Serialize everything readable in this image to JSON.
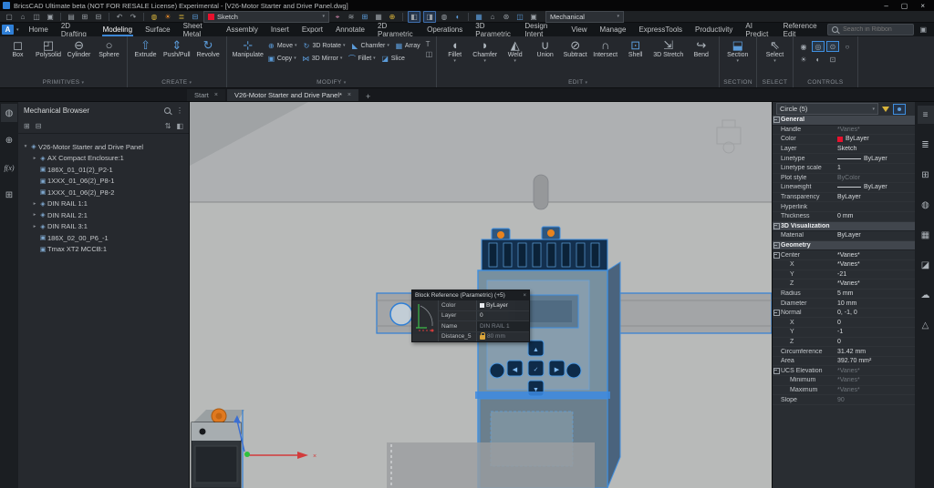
{
  "colors": {
    "accent": "#3c87d6",
    "selection_blue": "#2f7fd6",
    "layer_swatch_red": "#e8112d",
    "knob_orange": "#e0791f"
  },
  "window": {
    "title": "BricsCAD Ultimate beta (NOT FOR RESALE License) Experimental - [V26-Motor Starter and Drive Panel.dwg]",
    "controls": [
      {
        "name": "minimize",
        "g": "–"
      },
      {
        "name": "maximize",
        "g": "▢"
      },
      {
        "name": "close",
        "g": "×"
      }
    ]
  },
  "qat": {
    "left_icons": [
      {
        "n": "new-file-icon",
        "g": "▢"
      },
      {
        "n": "open-file-icon",
        "g": "⌂"
      },
      {
        "n": "save-icon",
        "g": "◫"
      },
      {
        "n": "save-all-icon",
        "g": "▣"
      },
      {
        "div": true
      },
      {
        "n": "new-sheet-icon",
        "g": "▤"
      },
      {
        "n": "plot-icon",
        "g": "⊞"
      },
      {
        "n": "publish-icon",
        "g": "⊟"
      },
      {
        "div": true
      },
      {
        "n": "undo-icon",
        "g": "↶"
      },
      {
        "n": "redo-icon",
        "g": "↷"
      },
      {
        "div": true
      },
      {
        "n": "lamp-icon",
        "g": "◍",
        "c": "y"
      },
      {
        "n": "sun-icon",
        "g": "☀",
        "c": "o"
      },
      {
        "n": "layers-icon",
        "g": "≣",
        "c": "y"
      },
      {
        "n": "print-icon",
        "g": "⊟",
        "c": "b"
      }
    ],
    "layer": {
      "name": "Sketch"
    },
    "mid_icons": [
      {
        "n": "annotation-monitor-icon",
        "g": "⌖",
        "c": "p"
      },
      {
        "n": "workspace-sync-icon",
        "g": "≋"
      },
      {
        "n": "snap-toggle-icon",
        "g": "⊞",
        "c": "b"
      },
      {
        "n": "grid-toggle-icon",
        "g": "▦"
      },
      {
        "n": "osnap-toggle-icon",
        "g": "⊕",
        "c": "y"
      },
      {
        "div": true
      },
      {
        "n": "quad-toggle-icon",
        "g": "◧",
        "f": true
      },
      {
        "n": "rollover-tips-icon",
        "g": "◨",
        "f": true
      },
      {
        "n": "world-ucs-icon",
        "g": "◍"
      },
      {
        "n": "shading-toggle-icon",
        "g": "◐",
        "c": "b"
      },
      {
        "div": true
      },
      {
        "n": "sheet-set-icon",
        "g": "▦",
        "c": "b"
      },
      {
        "n": "home-view-icon",
        "g": "⌂"
      },
      {
        "n": "settings-gear-icon",
        "g": "⊛"
      },
      {
        "n": "highlight-box-icon",
        "g": "◫",
        "c": "b"
      },
      {
        "n": "window-layout-icon",
        "g": "▣"
      }
    ],
    "workspace": "Mechanical"
  },
  "ribbon": {
    "search_placeholder": "Search in Ribbon",
    "tabs": [
      {
        "label": "Home"
      },
      {
        "label": "2D Drafting"
      },
      {
        "label": "Modeling",
        "active": true
      },
      {
        "label": "Surface"
      },
      {
        "label": "Sheet Metal"
      },
      {
        "label": "Assembly"
      },
      {
        "label": "Insert"
      },
      {
        "label": "Export"
      },
      {
        "label": "Annotate"
      },
      {
        "label": "2D Parametric"
      },
      {
        "label": "Operations"
      },
      {
        "label": "3D Parametric"
      },
      {
        "label": "Design Intent"
      },
      {
        "label": "View"
      },
      {
        "label": "Manage"
      },
      {
        "label": "ExpressTools"
      },
      {
        "label": "Productivity"
      },
      {
        "label": "AI Predict"
      },
      {
        "label": "Reference Edit"
      }
    ],
    "panels": [
      {
        "label": "PRIMITIVES",
        "caret": true,
        "kind": "big",
        "items": [
          {
            "label": "Box",
            "icon": "box-icon",
            "g": "◻"
          },
          {
            "label": "Polysolid",
            "icon": "polysolid-icon",
            "g": "◰"
          },
          {
            "label": "Cylinder",
            "icon": "cylinder-icon",
            "g": "⊖"
          },
          {
            "label": "Sphere",
            "icon": "sphere-icon",
            "g": "○"
          }
        ]
      },
      {
        "label": "CREATE",
        "caret": true,
        "kind": "big",
        "items": [
          {
            "label": "Extrude",
            "icon": "extrude-icon",
            "g": "⇧",
            "blue": true
          },
          {
            "label": "Push/Pull",
            "icon": "push-pull-icon",
            "g": "⇕",
            "blue": true
          },
          {
            "label": "Revolve",
            "icon": "revolve-icon",
            "g": "↻",
            "blue": true
          }
        ]
      },
      {
        "label": "MODIFY",
        "caret": true,
        "kind": "mixed",
        "big": [
          {
            "label": "Manipulate",
            "icon": "manipulate-icon",
            "g": "⊹",
            "blue": true
          }
        ],
        "rows": [
          [
            {
              "label": "Move",
              "icon": "move-icon",
              "g": "⊕",
              "caret": true
            },
            {
              "label": "3D Rotate",
              "icon": "rotate-3d-icon",
              "g": "↻",
              "caret": true
            },
            {
              "label": "Chamfer",
              "icon": "chamfer-icon",
              "g": "◣",
              "caret": true
            },
            {
              "label": "Array",
              "icon": "array-icon",
              "g": "▦"
            }
          ],
          [
            {
              "label": "Copy",
              "icon": "copy-icon",
              "g": "▣",
              "caret": true
            },
            {
              "label": "3D Mirror",
              "icon": "mirror-3d-icon",
              "g": "⋈",
              "caret": true
            },
            {
              "label": "Fillet",
              "icon": "fillet-icon",
              "g": "⌒",
              "caret": true
            },
            {
              "label": "Slice",
              "icon": "slice-icon",
              "g": "◪"
            }
          ]
        ],
        "tail": [
          {
            "icon": "text-style-icon",
            "g": "T"
          },
          {
            "icon": "convert-icon",
            "g": "◫"
          }
        ]
      },
      {
        "label": "EDIT",
        "caret": true,
        "kind": "big",
        "items": [
          {
            "label": "Fillet",
            "icon": "edit-fillet-icon",
            "g": "◖",
            "caret": true
          },
          {
            "label": "Chamfer",
            "icon": "edit-chamfer-icon",
            "g": "◗",
            "caret": true
          },
          {
            "label": "Weld",
            "icon": "weld-icon",
            "g": "◭",
            "caret": true
          },
          {
            "label": "Union",
            "icon": "union-icon",
            "g": "∪"
          },
          {
            "label": "Subtract",
            "icon": "subtract-icon",
            "g": "⊘"
          },
          {
            "label": "Intersect",
            "icon": "intersect-icon",
            "g": "∩"
          },
          {
            "label": "Shell",
            "icon": "shell-icon",
            "g": "⊡",
            "blue": true
          },
          {
            "label": "3D Stretch",
            "icon": "stretch-3d-icon",
            "g": "⇲"
          },
          {
            "label": "Bend",
            "icon": "bend-icon",
            "g": "↪"
          }
        ]
      },
      {
        "label": "SECTION",
        "kind": "big",
        "items": [
          {
            "label": "Section",
            "icon": "section-icon",
            "g": "⬓",
            "caret": true,
            "blue": true
          }
        ]
      },
      {
        "label": "SELECT",
        "kind": "big",
        "items": [
          {
            "label": "Select",
            "icon": "select-icon",
            "g": "⇖",
            "caret": true
          }
        ]
      },
      {
        "label": "CONTROLS",
        "kind": "grid",
        "rows": [
          [
            {
              "icon": "camera-swivel-icon",
              "g": "◉"
            },
            {
              "icon": "look-from-icon",
              "g": "◎",
              "active": true
            },
            {
              "icon": "orbit-icon",
              "g": "⊙",
              "active": true
            },
            {
              "icon": "walk-icon",
              "g": "○"
            }
          ],
          [
            {
              "icon": "light-icon",
              "g": "☀"
            },
            {
              "icon": "shadow-icon",
              "g": "◐"
            },
            {
              "icon": "box-select-icon",
              "g": "⊡"
            }
          ]
        ]
      }
    ]
  },
  "doc_tabs": {
    "tabs": [
      {
        "label": "Start",
        "close": "×"
      },
      {
        "label": "V26-Motor Starter and Drive Panel*",
        "close": "×",
        "active": true
      }
    ],
    "add": "+"
  },
  "left_strip": [
    {
      "name": "tips-icon",
      "g": "◍",
      "active": true
    },
    {
      "name": "mechanical-browser-icon",
      "g": "⊕"
    },
    {
      "name": "parameters-fx-icon",
      "g": "f(x)",
      "fx": true
    },
    {
      "name": "structure-icon",
      "g": "⊞"
    }
  ],
  "browser": {
    "title": "Mechanical Browser",
    "tools_left": [
      {
        "n": "group-by-icon",
        "g": "⊞"
      },
      {
        "n": "filter-icon",
        "g": "⊟",
        "red": true
      }
    ],
    "tools_right": [
      {
        "n": "sort-icon",
        "g": "⇅"
      },
      {
        "n": "detail-toggle-icon",
        "g": "◧"
      }
    ],
    "tree": [
      {
        "label": "V26-Motor Starter and Drive Panel",
        "chevron": "open",
        "indent": 0,
        "icon": "assembly"
      },
      {
        "label": "AX Compact Enclosure:1",
        "chevron": "closed",
        "indent": 1,
        "icon": "component"
      },
      {
        "label": "186X_01_01(2)_P2-1",
        "chevron": "",
        "indent": 1,
        "icon": "block"
      },
      {
        "label": "1XXX_01_06(2)_P8-1",
        "chevron": "",
        "indent": 1,
        "icon": "block"
      },
      {
        "label": "1XXX_01_06(2)_P8-2",
        "chevron": "",
        "indent": 1,
        "icon": "block"
      },
      {
        "label": "DIN RAIL 1:1",
        "chevron": "closed",
        "indent": 1,
        "icon": "component"
      },
      {
        "label": "DIN RAIL 2:1",
        "chevron": "closed",
        "indent": 1,
        "icon": "component"
      },
      {
        "label": "DIN RAIL 3:1",
        "chevron": "closed",
        "indent": 1,
        "icon": "component"
      },
      {
        "label": "186X_02_00_P6_-1",
        "chevron": "",
        "indent": 1,
        "icon": "block"
      },
      {
        "label": "Tmax XT2 MCCB:1",
        "chevron": "",
        "indent": 1,
        "icon": "block"
      }
    ]
  },
  "tooltip": {
    "title": "Block Reference (Parametric) (+5)",
    "close": "×",
    "rows": [
      {
        "label": "Color",
        "value": "ByLayer",
        "swatch": true
      },
      {
        "label": "Layer",
        "value": "0"
      },
      {
        "label": "Name",
        "value": "DIN RAIL 1",
        "dim": true,
        "field": true
      },
      {
        "label": "Distance_5",
        "value": "80 mm",
        "dim": true,
        "lock": true
      }
    ]
  },
  "properties": {
    "selector": "Circle (5)",
    "rows": [
      {
        "t": "section",
        "label": "General"
      },
      {
        "t": "row",
        "label": "Handle",
        "value": "*Varies*",
        "dim": true
      },
      {
        "t": "row",
        "label": "Color",
        "value": "ByLayer",
        "swatch": true
      },
      {
        "t": "row",
        "label": "Layer",
        "value": "Sketch"
      },
      {
        "t": "row",
        "label": "Linetype",
        "value": "ByLayer",
        "line": true
      },
      {
        "t": "row",
        "label": "Linetype scale",
        "value": "1"
      },
      {
        "t": "row",
        "label": "Plot style",
        "value": "ByColor",
        "dim": true
      },
      {
        "t": "row",
        "label": "Lineweight",
        "value": "ByLayer",
        "line": true
      },
      {
        "t": "row",
        "label": "Transparency",
        "value": "ByLayer"
      },
      {
        "t": "row",
        "label": "Hyperlink",
        "value": ""
      },
      {
        "t": "row",
        "label": "Thickness",
        "value": "0 mm"
      },
      {
        "t": "section",
        "label": "3D Visualization"
      },
      {
        "t": "row",
        "label": "Material",
        "value": "ByLayer"
      },
      {
        "t": "section",
        "label": "Geometry"
      },
      {
        "t": "row",
        "label": "Center",
        "value": "*Varies*",
        "expand": true
      },
      {
        "t": "row",
        "label": "X",
        "value": "*Varies*",
        "indent": true
      },
      {
        "t": "row",
        "label": "Y",
        "value": "-21",
        "indent": true
      },
      {
        "t": "row",
        "label": "Z",
        "value": "*Varies*",
        "indent": true
      },
      {
        "t": "row",
        "label": "Radius",
        "value": "5 mm"
      },
      {
        "t": "row",
        "label": "Diameter",
        "value": "10 mm"
      },
      {
        "t": "row",
        "label": "Normal",
        "value": "0, -1, 0",
        "expand": true
      },
      {
        "t": "row",
        "label": "X",
        "value": "0",
        "indent": true
      },
      {
        "t": "row",
        "label": "Y",
        "value": "-1",
        "indent": true
      },
      {
        "t": "row",
        "label": "Z",
        "value": "0",
        "indent": true
      },
      {
        "t": "row",
        "label": "Circumference",
        "value": "31.42 mm"
      },
      {
        "t": "row",
        "label": "Area",
        "value": "392.70 mm²"
      },
      {
        "t": "row",
        "label": "UCS Elevation",
        "value": "*Varies*",
        "dim": true,
        "expand": true
      },
      {
        "t": "row",
        "label": "Minimum",
        "value": "*Varies*",
        "dim": true,
        "indent": true
      },
      {
        "t": "row",
        "label": "Maximum",
        "value": "*Varies*",
        "dim": true,
        "indent": true
      },
      {
        "t": "row",
        "label": "Slope",
        "value": "90",
        "dim": true
      }
    ]
  },
  "right_strip": [
    {
      "name": "properties-panel-icon",
      "g": "≡",
      "active": true
    },
    {
      "name": "layers-panel-icon",
      "g": "≣"
    },
    {
      "name": "blocks-panel-icon",
      "g": "⊞"
    },
    {
      "name": "attachments-panel-icon",
      "g": "◍"
    },
    {
      "name": "sheets-panel-icon",
      "g": "▦"
    },
    {
      "name": "materials-panel-icon",
      "g": "◪"
    },
    {
      "name": "render-cloud-icon",
      "g": "☁"
    },
    {
      "name": "warnings-icon",
      "g": "△"
    }
  ]
}
